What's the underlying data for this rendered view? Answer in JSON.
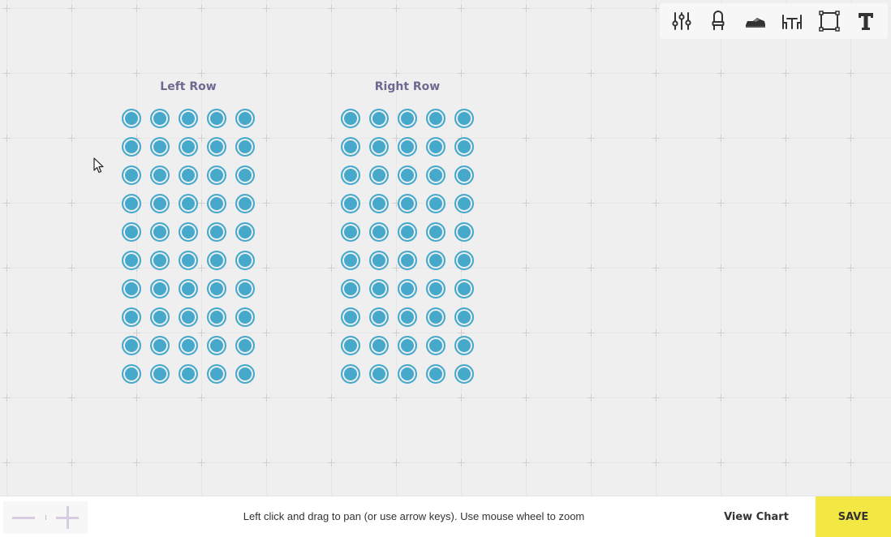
{
  "toolbar": {
    "tools": [
      {
        "icon": "sliders-icon"
      },
      {
        "icon": "chair-icon"
      },
      {
        "icon": "shoe-icon"
      },
      {
        "icon": "table-icon"
      },
      {
        "icon": "shape-select-icon"
      },
      {
        "icon": "text-icon",
        "glyph": "T"
      }
    ]
  },
  "sections": [
    {
      "label": "Left Row",
      "rows": 10,
      "cols": 5
    },
    {
      "label": "Right Row",
      "rows": 10,
      "cols": 5
    }
  ],
  "colors": {
    "seat": "#46a9cc",
    "label": "#6f6890",
    "save": "#f3e743",
    "zoom": "#d6cde0"
  },
  "bottom_bar": {
    "hint": "Left click and drag to pan (or use arrow keys). Use mouse wheel to zoom",
    "view_chart_label": "View Chart",
    "save_label": "SAVE"
  }
}
